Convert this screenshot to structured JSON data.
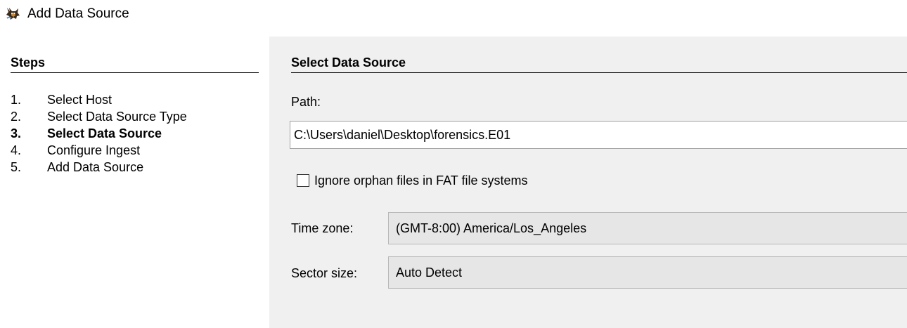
{
  "window": {
    "title": "Add Data Source",
    "icon": "autopsy-dog-icon"
  },
  "steps": {
    "heading": "Steps",
    "items": [
      {
        "number": "1.",
        "label": "Select Host",
        "active": false
      },
      {
        "number": "2.",
        "label": "Select Data Source Type",
        "active": false
      },
      {
        "number": "3.",
        "label": "Select Data Source",
        "active": true
      },
      {
        "number": "4.",
        "label": "Configure Ingest",
        "active": false
      },
      {
        "number": "5.",
        "label": "Add Data Source",
        "active": false
      }
    ]
  },
  "content": {
    "heading": "Select Data Source",
    "path_label": "Path:",
    "path_value": "C:\\Users\\daniel\\Desktop\\forensics.E01",
    "orphan_checkbox": {
      "label": "Ignore orphan files in FAT file systems",
      "checked": false
    },
    "timezone": {
      "label": "Time zone:",
      "value": "(GMT-8:00) America/Los_Angeles"
    },
    "sector_size": {
      "label": "Sector size:",
      "value": "Auto Detect"
    }
  }
}
